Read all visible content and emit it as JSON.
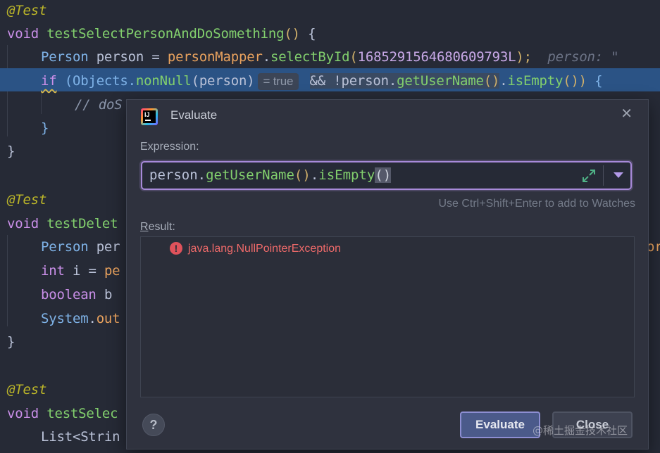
{
  "editor": {
    "lines": [
      {
        "text": "@Test"
      },
      {
        "method_kw": "void",
        "method_name": "testSelectPersonAndDoSomething",
        "parens": "()",
        "brace": "{"
      },
      {
        "type": "Person",
        "var": "person = ",
        "field": "personMapper",
        "dot": ".",
        "call": "selectById",
        "open": "(",
        "num": "1685291564680609793L",
        "close": ");",
        "hint": "person: \""
      },
      {
        "kw": "if",
        "open": "(Objects.",
        "call": "nonNull",
        "arg": "(person)",
        "inline_hint": "= true",
        "op": "&& !person.",
        "call2": "getUserName",
        "parens2": "()",
        "dot2": ".",
        "call3": "isEmpty",
        "parens3": "())",
        "brace": "{"
      },
      {
        "comment": "// doS"
      },
      {
        "text": "}"
      },
      {
        "text": "}"
      },
      {
        "text": "@Test"
      },
      {
        "method_kw": "void",
        "method_name": "testDelet"
      },
      {
        "type": "Person",
        "rest": "per",
        "overflow": "or"
      },
      {
        "kw": "int",
        "rest": "i = ",
        "field": "pe"
      },
      {
        "kw": "boolean",
        "rest": "b"
      },
      {
        "type": "System",
        "dot": ".",
        "field": "out"
      },
      {
        "text": "}"
      },
      {
        "text": "@Test"
      },
      {
        "method_kw": "void",
        "method_name": "testSelec"
      },
      {
        "type": "List<Strin"
      }
    ]
  },
  "dialog": {
    "title": "Evaluate",
    "close_label": "✕",
    "expression_label": "Expression:",
    "expression": {
      "obj": "person.",
      "m1": "getUserName",
      "p1": "()",
      "dot": ".",
      "m2": "isEmpty",
      "p2": "()"
    },
    "watches_hint": "Use Ctrl+Shift+Enter to add to Watches",
    "result_label_first": "R",
    "result_label_rest": "esult:",
    "result": {
      "error_icon": "!",
      "text": "java.lang.NullPointerException"
    },
    "help_label": "?",
    "evaluate_label": "Evaluate",
    "close_button_label": "Close"
  },
  "watermark": "@稀土掘金技术社区",
  "colors": {
    "accent": "#a78ad9",
    "error": "#ef6a6a",
    "selection": "#2b5385"
  }
}
